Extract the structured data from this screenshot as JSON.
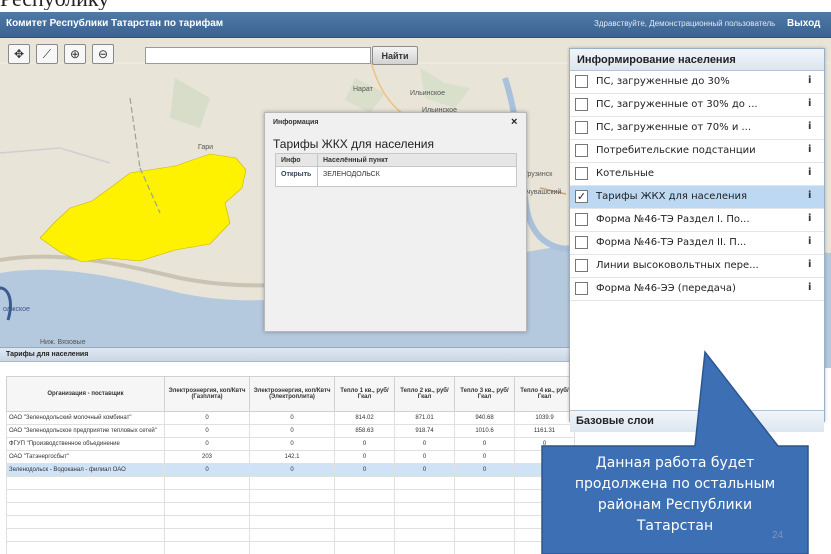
{
  "app": {
    "title": "Комитет Республики Татарстан по тарифам",
    "greeting": "Здравствуйте, Демонстрационный пользователь",
    "exit": "Выход"
  },
  "map": {
    "search_placeholder": "",
    "search_button": "Найти",
    "labels": {
      "narat": "Нарат",
      "ilinskoe": "Ильинское",
      "ilinskoe2": "Ильинское",
      "gari": "Гари",
      "gruzinsk": "Грузинск",
      "kuvashsky": "очувашский",
      "volzhskoe": "олжское",
      "niz_vyazovye": "Ниж. Вязовые"
    }
  },
  "popup": {
    "header": "Информация",
    "close": "×",
    "title": "Тарифы ЖКХ для населения",
    "columns": [
      "Инфо",
      "Населённый пункт"
    ],
    "rows": [
      {
        "info": "Открыть",
        "place": "ЗЕЛЕНОДОЛЬСК"
      }
    ]
  },
  "bottom_panel": {
    "title": "Тарифы для населения",
    "columns": [
      "Организация - поставщик",
      "Электроэнергия, коп/Квтч (Газплита)",
      "Электроэнергия, коп/Квтч (Электроплита)",
      "Тепло 1 кв., руб/Гкал",
      "Тепло 2 кв., руб/Гкал",
      "Тепло 3 кв., руб/Гкал",
      "Тепло 4 кв., руб/Гкал"
    ],
    "rows": [
      [
        "ОАО \"Зеленодольский молочный комбинат\"",
        "0",
        "0",
        "814.02",
        "871.01",
        "940.68",
        "1039.9"
      ],
      [
        "ОАО \"Зеленодольское предприятие тепловых сетей\"",
        "0",
        "0",
        "858.63",
        "918.74",
        "1010.6",
        "1161.31"
      ],
      [
        "ФГУП \"Производственное объединение",
        "0",
        "0",
        "0",
        "0",
        "0",
        "0"
      ],
      [
        "ОАО \"Татэнергосбыт\"",
        "203",
        "142.1",
        "0",
        "0",
        "0",
        "0"
      ],
      [
        "Зеленодольск - Водоканал - филиал ОАО",
        "0",
        "0",
        "0",
        "0",
        "0",
        "0"
      ]
    ],
    "selected_row": 4
  },
  "layers_panel": {
    "title": "Информирование населения",
    "items": [
      {
        "label": "ПС, загруженные до 30%",
        "checked": "",
        "info": "i"
      },
      {
        "label": "ПС, загруженные от 30% до ...",
        "checked": "",
        "info": "i"
      },
      {
        "label": "ПС, загруженные от 70% и ...",
        "checked": "",
        "info": "i"
      },
      {
        "label": "Потребительские подстанции",
        "checked": "",
        "info": "i"
      },
      {
        "label": "Котельные",
        "checked": "",
        "info": "i"
      },
      {
        "label": "Тарифы ЖКХ для населения",
        "checked": "✓",
        "info": "i"
      },
      {
        "label": "Форма №46-ТЭ Раздел I. По...",
        "checked": "",
        "info": "i"
      },
      {
        "label": "Форма №46-ТЭ Раздел II. П...",
        "checked": "",
        "info": "i"
      },
      {
        "label": "Линии высоковольтных пере...",
        "checked": "",
        "info": "i"
      },
      {
        "label": "Форма №46-ЭЭ (передача)",
        "checked": "",
        "info": "i"
      }
    ],
    "base_layers": "Базовые слои"
  },
  "callout": {
    "lines": [
      "Данная работа будет",
      "продолжена по остальным",
      "районам Республики",
      "Татарстан"
    ],
    "color": "#3c6fb4"
  },
  "slide": {
    "title": "Республику",
    "number": "24"
  }
}
